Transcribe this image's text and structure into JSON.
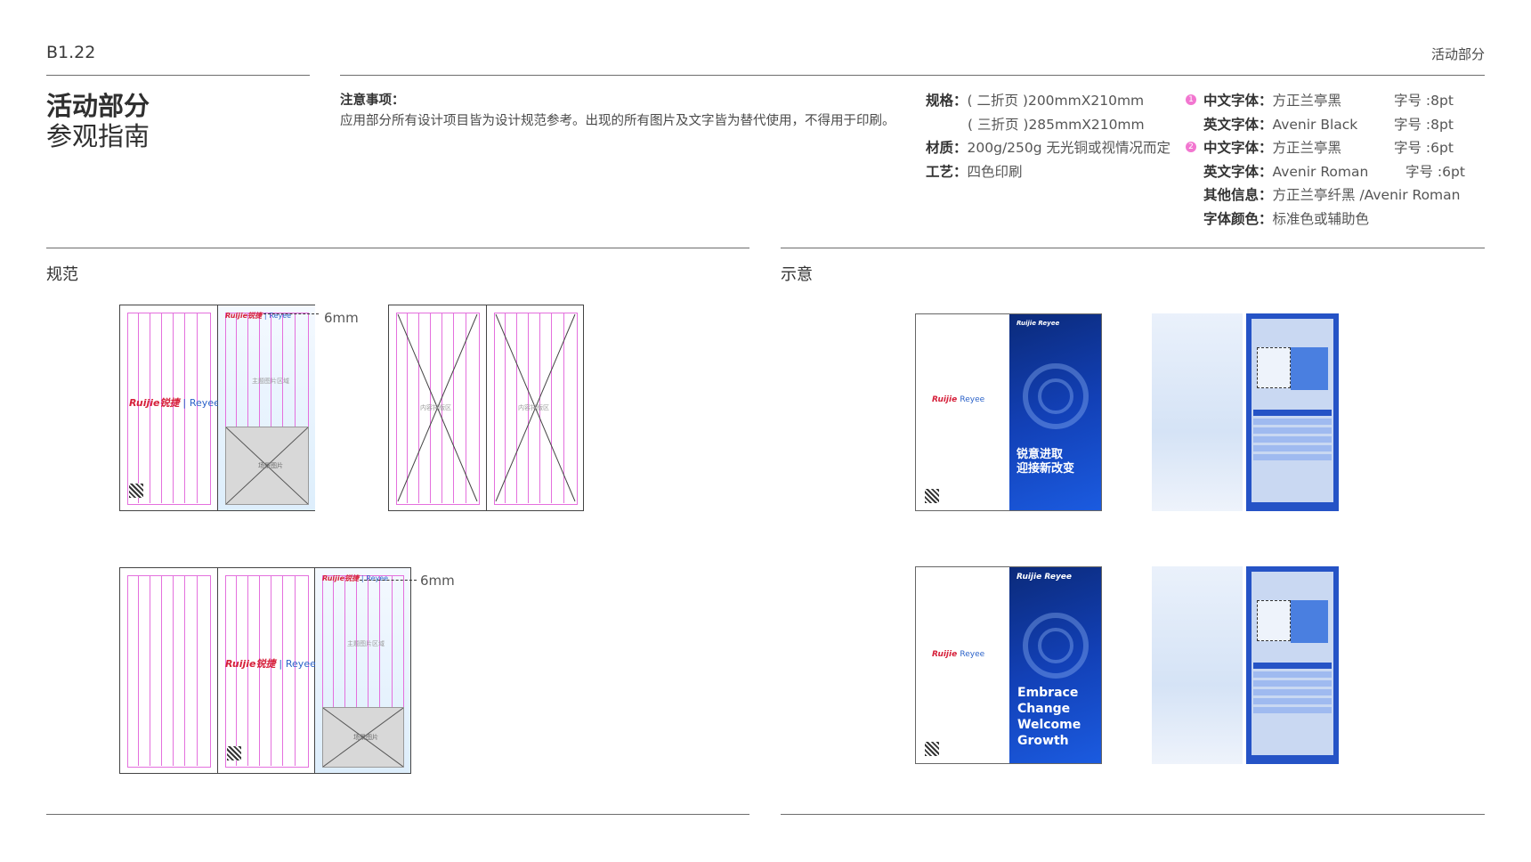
{
  "header": {
    "page_code": "B1.22",
    "section": "活动部分"
  },
  "title": {
    "line1": "活动部分",
    "line2": "参观指南"
  },
  "notice": {
    "heading": "注意事项：",
    "body": "应用部分所有设计项目皆为设计规范参考。出现的所有图片及文字皆为替代使用，不得用于印刷。"
  },
  "spec": {
    "size_label": "规格：",
    "size_value_1": "( 二折页 )200mmX210mm",
    "size_value_2": "( 三折页 )285mmX210mm",
    "material_label": "材质：",
    "material_value": "200g/250g 无光铜或视情况而定",
    "craft_label": "工艺：",
    "craft_value": "四色印刷"
  },
  "fonts": {
    "badge1": "1",
    "badge2": "2",
    "rows": [
      {
        "label": "中文字体：",
        "value": "方正兰亭黑",
        "size": "字号 :8pt"
      },
      {
        "label": "英文字体：",
        "value": "Avenir Black",
        "size": "字号 :8pt"
      },
      {
        "label": "中文字体：",
        "value": "方正兰亭黑",
        "size": "字号 :6pt"
      },
      {
        "label": "英文字体：",
        "value": "Avenir Roman",
        "size": "字号 :6pt"
      },
      {
        "label": "其他信息：",
        "value": "方正兰亭纤黑 /Avenir Roman",
        "size": ""
      },
      {
        "label": "字体颜色：",
        "value": "标准色或辅助色",
        "size": ""
      }
    ]
  },
  "sections": {
    "spec_label": "规范",
    "sample_label": "示意"
  },
  "spec_panels": {
    "margin_label": "6mm",
    "content_area": "内容排版区",
    "title_area": "主题图片区域",
    "image_area": "场景图片",
    "brand_main": "Ruijie锐捷",
    "brand_sep": "|",
    "brand_sub": "Reyee"
  },
  "mockups": {
    "cover_cn_line1": "锐意进取",
    "cover_cn_line2": "迎接新改变",
    "cover_en_line1": "Embrace",
    "cover_en_line2": "Change",
    "cover_en_line3": "Welcome",
    "cover_en_line4": "Growth",
    "brand_main": "Ruijie",
    "brand_sub": "Reyee"
  },
  "colors": {
    "magenta_guide": "#e470dd",
    "brand_red": "#d6213b",
    "brand_blue": "#1240b6"
  }
}
